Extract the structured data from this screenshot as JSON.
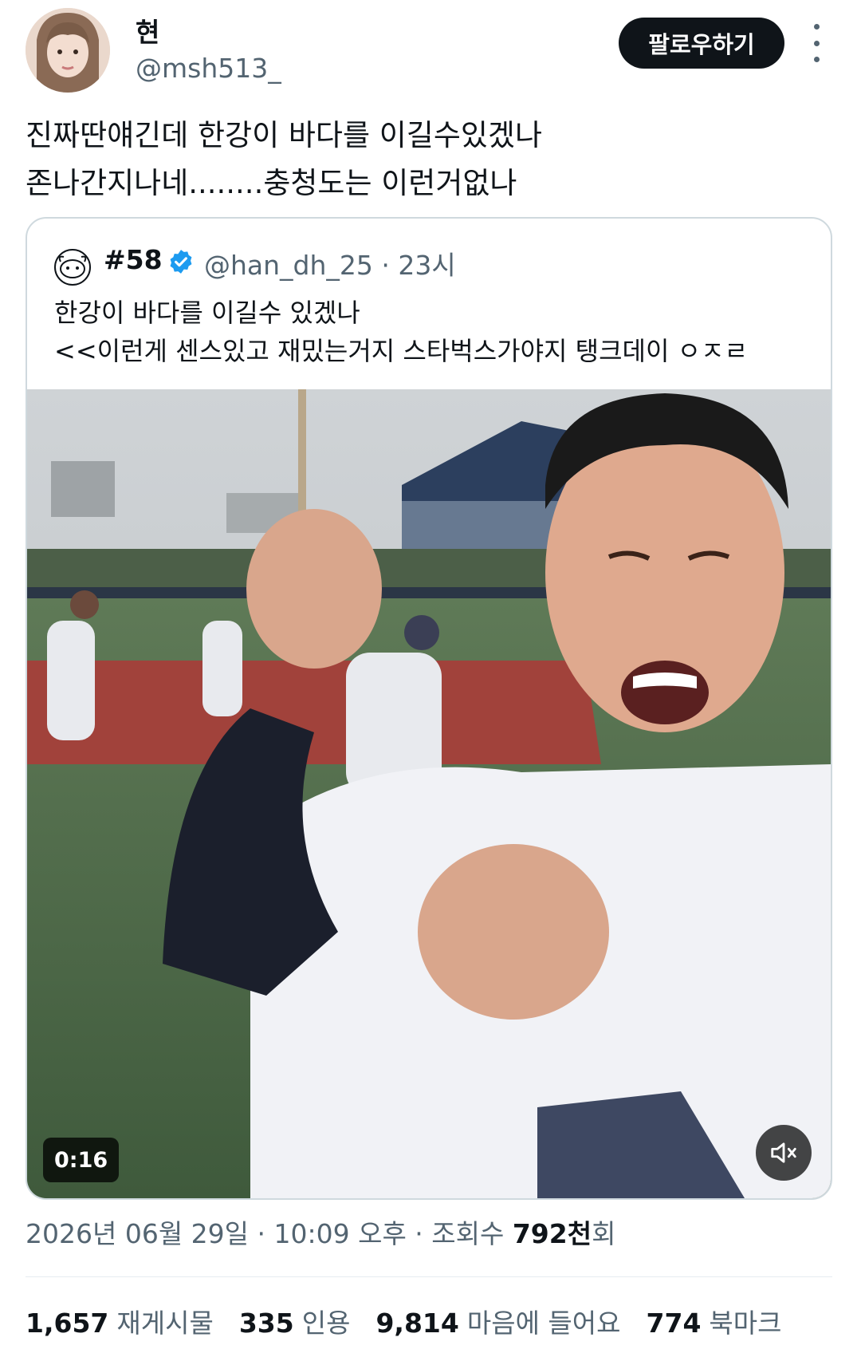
{
  "author": {
    "display_name": "현",
    "handle": "@msh513_",
    "follow_label": "팔로우하기"
  },
  "tweet": {
    "lines": [
      "진짜딴얘긴데 한강이 바다를 이길수있겠나",
      "존나간지나네........충청도는 이런거없나"
    ]
  },
  "quote": {
    "name": "#58",
    "handle_time": "@han_dh_25 · 23시",
    "lines": [
      "한강이 바다를 이길수 있겠나",
      "<<이런게 센스있고 재밌는거지 스타벅스가야지 탱크데이 ㅇㅈㄹ"
    ],
    "video": {
      "duration": "0:16",
      "muted": true
    }
  },
  "meta": {
    "date_time": "2026년 06월 29일 · 10:09 오후 · 조회수 ",
    "views": "792천",
    "views_suffix": "회"
  },
  "stats": [
    {
      "value": "1,657",
      "label": "재게시물"
    },
    {
      "value": "335",
      "label": "인용"
    },
    {
      "value": "9,814",
      "label": "마음에 들어요"
    },
    {
      "value": "774",
      "label": "북마크"
    }
  ],
  "colors": {
    "accent": "#1d9bf0",
    "text": "#0f1419",
    "secondary": "#536471",
    "button": "#0f1419"
  },
  "icons": [
    "avatar",
    "more-icon",
    "verified-badge-icon",
    "mute-icon"
  ]
}
